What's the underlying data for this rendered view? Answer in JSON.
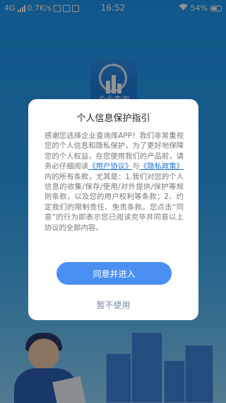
{
  "status_bar": {
    "network": "4G",
    "speed": "0.7K/s",
    "time": "16:52",
    "battery": "54%"
  },
  "app": {
    "name": "企业查询"
  },
  "dialog": {
    "title": "个人信息保护指引",
    "body_part1": "感谢您选择企业查询库APP！我们非常重视您的个人信息和隐私保护，为了更好地保障您的个人权益，在您使用我们的产品前，请务必仔细阅读",
    "link_user_agreement": "《用户协议》",
    "connector": "与",
    "link_privacy_policy": "《隐私政策》",
    "body_part2": "内的所有条款，尤其是：1.我们对您的个人信息的收集/保存/使用/对外提供/保护等规则条款，以及您的用户权利等条款；2、约定我们的限制责任、免责条款。您点击“同意”的行为即表示您已阅读完毕并同意以上协议的全部内容。",
    "agree_button": "同意并进入",
    "decline_button": "暂不使用"
  }
}
